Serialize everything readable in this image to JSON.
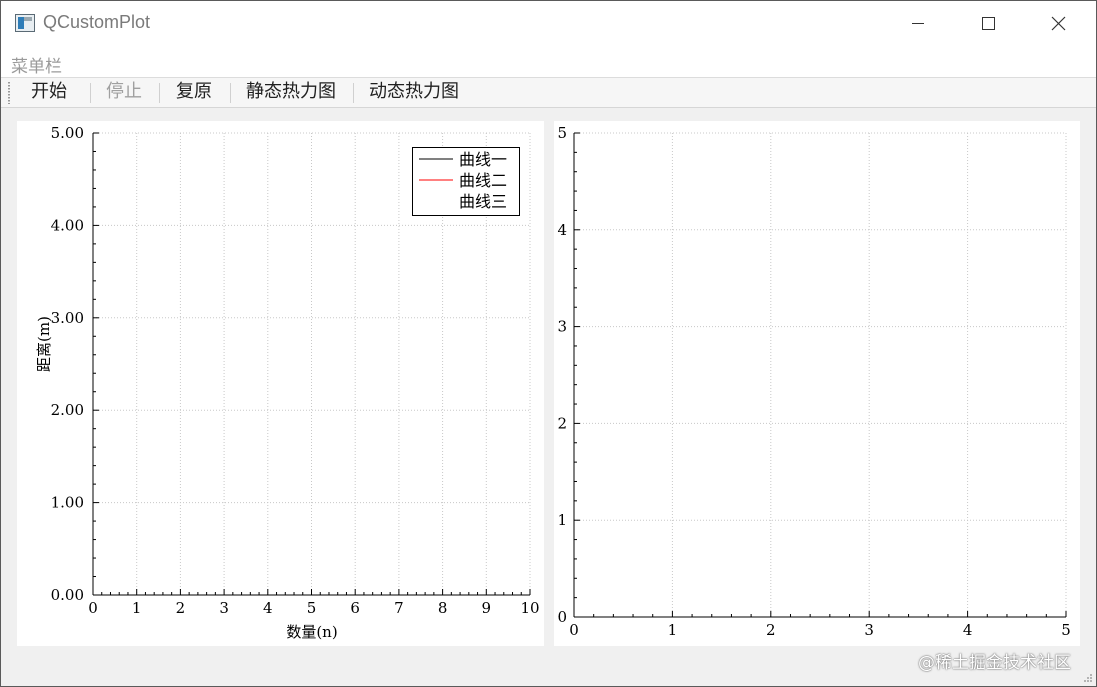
{
  "window": {
    "title": "QCustomPlot"
  },
  "menubar": {
    "label": "菜单栏"
  },
  "toolbar": {
    "start": "开始",
    "stop": "停止",
    "reset": "复原",
    "static_heatmap": "静态热力图",
    "dynamic_heatmap": "动态热力图"
  },
  "watermark": "@稀土掘金技术社区",
  "chart_data": [
    {
      "type": "line",
      "xlabel": "数量(n)",
      "ylabel": "距离(m)",
      "xlim": [
        0,
        10
      ],
      "ylim": [
        0,
        5
      ],
      "x_ticks": [
        "0",
        "1",
        "2",
        "3",
        "4",
        "5",
        "6",
        "7",
        "8",
        "9",
        "10"
      ],
      "y_ticks": [
        "0.00",
        "1.00",
        "2.00",
        "3.00",
        "4.00",
        "5.00"
      ],
      "grid": true,
      "legend_placement": "top-right",
      "series": [
        {
          "name": "曲线一",
          "color": "#000000",
          "x": [],
          "y": []
        },
        {
          "name": "曲线二",
          "color": "#ff0000",
          "x": [],
          "y": []
        },
        {
          "name": "曲线三",
          "color": "#ffffff",
          "x": [],
          "y": []
        }
      ]
    },
    {
      "type": "heatmap",
      "xlim": [
        0,
        5
      ],
      "ylim": [
        0,
        5
      ],
      "x_ticks": [
        "0",
        "1",
        "2",
        "3",
        "4",
        "5"
      ],
      "y_ticks": [
        "0",
        "1",
        "2",
        "3",
        "4",
        "5"
      ],
      "grid": true,
      "values": []
    }
  ]
}
